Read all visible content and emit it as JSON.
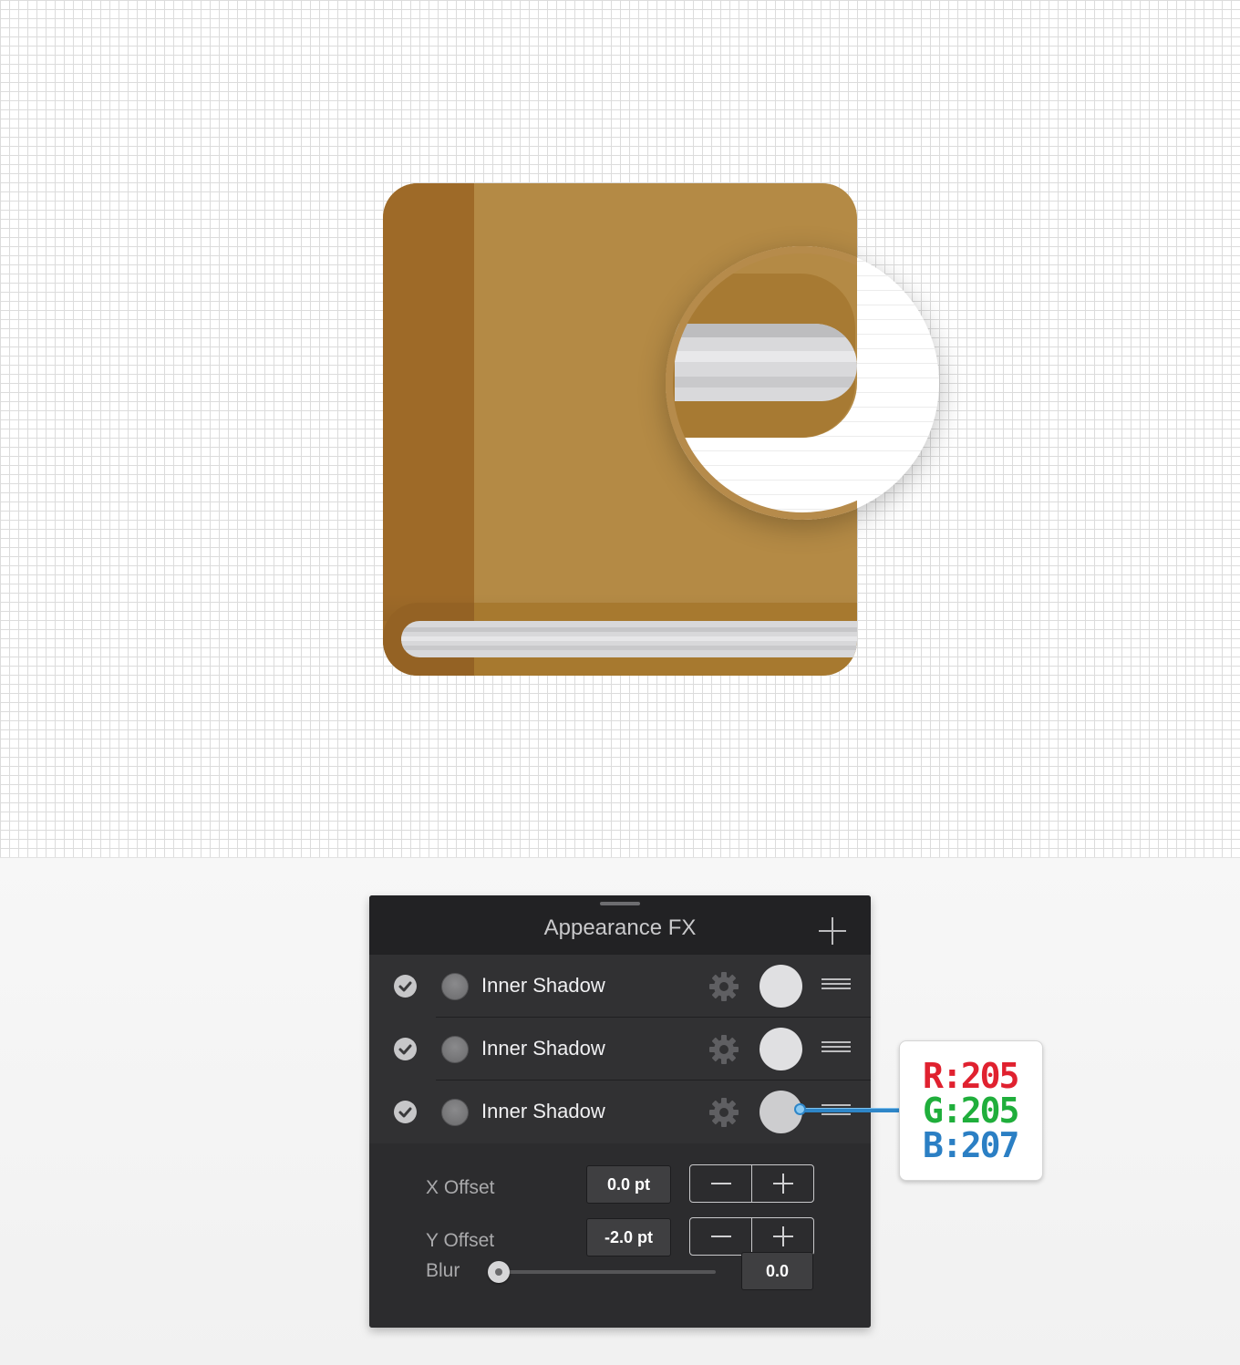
{
  "panel": {
    "title": "Appearance FX",
    "effects": [
      {
        "label": "Inner Shadow",
        "enabled": true,
        "swatch_color": "#e0e0e2"
      },
      {
        "label": "Inner Shadow",
        "enabled": true,
        "swatch_color": "#e0e0e2"
      },
      {
        "label": "Inner Shadow",
        "enabled": true,
        "swatch_color": "#cdcdcf"
      }
    ],
    "x_offset": {
      "label": "X Offset",
      "value": "0.0 pt"
    },
    "y_offset": {
      "label": "Y Offset",
      "value": "-2.0 pt"
    },
    "blur": {
      "label": "Blur",
      "value": "0.0"
    }
  },
  "annotation": {
    "r": "R:205",
    "g": "G:205",
    "b": "B:207",
    "r_color": "#e0212f",
    "g_color": "#1fae3b",
    "b_color": "#2b7fc4"
  },
  "illustration": {
    "cover_color": "#b48a45",
    "spine_color": "#9e6a28",
    "pages_color": "#d8d8da"
  }
}
